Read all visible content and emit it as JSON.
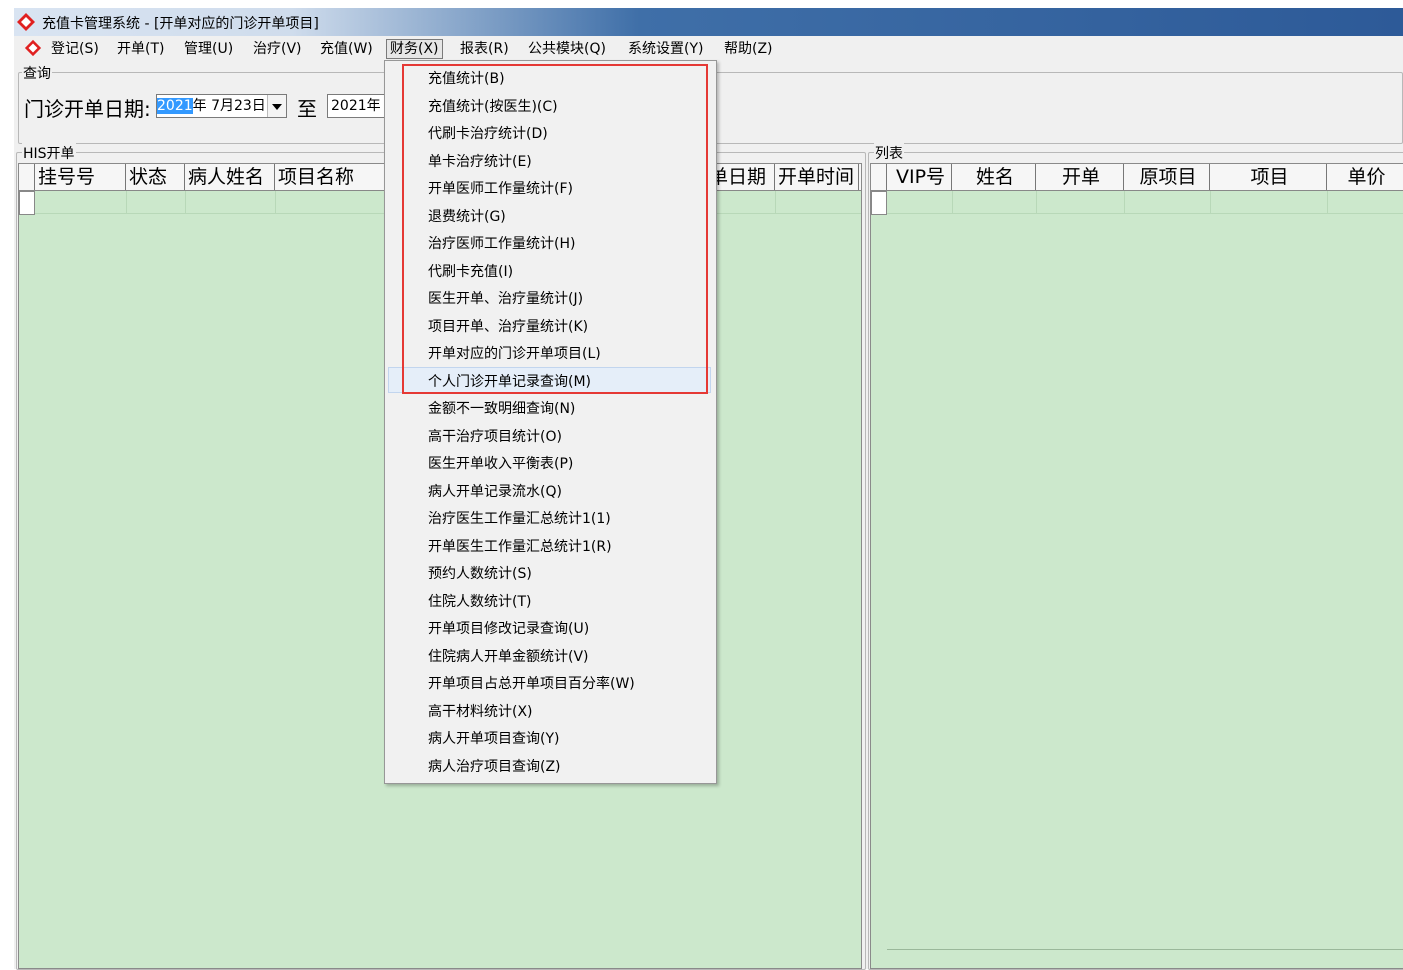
{
  "window": {
    "title": "充值卡管理系统 - [开单对应的门诊开单项目]"
  },
  "menubar": {
    "items": [
      {
        "label": "登记(S)"
      },
      {
        "label": "开单(T)"
      },
      {
        "label": "管理(U)"
      },
      {
        "label": "治疗(V)"
      },
      {
        "label": "充值(W)"
      },
      {
        "label": "财务(X)"
      },
      {
        "label": "报表(R)"
      },
      {
        "label": "公共模块(Q)"
      },
      {
        "label": "系统设置(Y)"
      },
      {
        "label": "帮助(Z)"
      }
    ]
  },
  "query": {
    "group_label": "查询",
    "date_label": "门诊开单日期:",
    "start_date_year_selected": "2021",
    "start_date_rest": "年  7月23日",
    "to_label": "至",
    "end_date": "2021年"
  },
  "his_panel": {
    "group_label": "HIS开单",
    "columns": [
      "挂号号",
      "状态",
      "病人姓名",
      "项目名称",
      "单日期",
      "开单时间"
    ]
  },
  "list_panel": {
    "group_label": "列表",
    "columns": [
      "VIP号",
      "姓名",
      "开单",
      "原项目",
      "项目",
      "单价"
    ]
  },
  "finance_menu": {
    "items": [
      {
        "label": "充值统计(B)"
      },
      {
        "label": "充值统计(按医生)(C)"
      },
      {
        "label": "代刷卡治疗统计(D)"
      },
      {
        "label": "单卡治疗统计(E)"
      },
      {
        "label": "开单医师工作量统计(F)"
      },
      {
        "label": "退费统计(G)"
      },
      {
        "label": "治疗医师工作量统计(H)"
      },
      {
        "label": "代刷卡充值(I)"
      },
      {
        "label": "医生开单、治疗量统计(J)"
      },
      {
        "label": "项目开单、治疗量统计(K)"
      },
      {
        "label": "开单对应的门诊开单项目(L)"
      },
      {
        "label": "个人门诊开单记录查询(M)"
      },
      {
        "label": "金额不一致明细查询(N)"
      },
      {
        "label": "高干治疗项目统计(O)"
      },
      {
        "label": "医生开单收入平衡表(P)"
      },
      {
        "label": "病人开单记录流水(Q)"
      },
      {
        "label": "治疗医生工作量汇总统计1(1)"
      },
      {
        "label": "开单医生工作量汇总统计1(R)"
      },
      {
        "label": "预约人数统计(S)"
      },
      {
        "label": "住院人数统计(T)"
      },
      {
        "label": "开单项目修改记录查询(U)"
      },
      {
        "label": "住院病人开单金额统计(V)"
      },
      {
        "label": "开单项目占总开单项目百分率(W)"
      },
      {
        "label": "高干材料统计(X)"
      },
      {
        "label": "病人开单项目查询(Y)"
      },
      {
        "label": "病人治疗项目查询(Z)"
      }
    ],
    "hovered_item": "个人门诊开单记录查询(M)"
  },
  "colors": {
    "grid_bg": "#cce8cc",
    "highlight_box": "#e53935",
    "selection": "#3399ff",
    "logo_red": "#e02020"
  }
}
